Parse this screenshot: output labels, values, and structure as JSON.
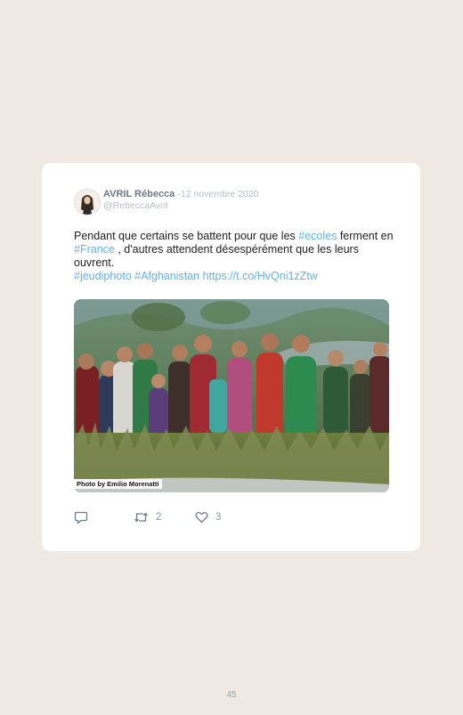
{
  "tweet": {
    "author_name": "AVRIL Rébecca",
    "date": "12 novembre 2020",
    "handle": "@RebeccaAvril",
    "text": {
      "part1": "Pendant que certains se battent pour que les ",
      "tag1": "#ecoles",
      "part2": " ferment en ",
      "tag2": "#France",
      "part3": " , d'autres attendent désespérément que les leurs ouvrent.",
      "tag3": "#jeudiphoto",
      "tag4": "#Afghanistan",
      "link": "https://t.co/HvQni1zZtw"
    },
    "image": {
      "credit": "Photo by Emilio Morenatti"
    },
    "actions": {
      "retweet_count": "2",
      "like_count": "3"
    }
  },
  "page": {
    "number": "45"
  },
  "icons": {
    "reply": "reply-icon",
    "retweet": "retweet-icon",
    "like": "heart-icon"
  },
  "colors": {
    "background": "#efe8e3",
    "card": "#ffffff",
    "link": "#5cb3e6",
    "muted": "#b7bec4",
    "icon": "#8b97a2"
  }
}
